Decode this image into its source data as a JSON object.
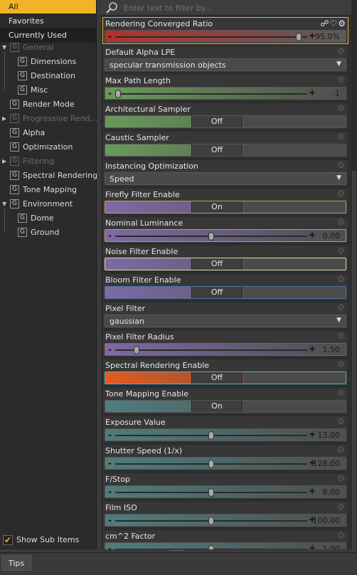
{
  "sidebar": {
    "top": [
      {
        "label": "All",
        "state": "active"
      },
      {
        "label": "Favorites",
        "state": "normal"
      },
      {
        "label": "Currently Used",
        "state": "used"
      }
    ],
    "tree": [
      {
        "label": "General",
        "level": 0,
        "arrow": "▼",
        "disabled": true
      },
      {
        "label": "Dimensions",
        "level": 1,
        "arrow": "",
        "disabled": false
      },
      {
        "label": "Destination",
        "level": 1,
        "arrow": "",
        "disabled": false
      },
      {
        "label": "Misc",
        "level": 1,
        "arrow": "",
        "disabled": false
      },
      {
        "label": "Render Mode",
        "level": 0,
        "arrow": "",
        "disabled": false
      },
      {
        "label": "Progressive Rend...",
        "level": 0,
        "arrow": "▶",
        "disabled": true
      },
      {
        "label": "Alpha",
        "level": 0,
        "arrow": "",
        "disabled": false
      },
      {
        "label": "Optimization",
        "level": 0,
        "arrow": "",
        "disabled": false
      },
      {
        "label": "Filtering",
        "level": 0,
        "arrow": "▶",
        "disabled": true
      },
      {
        "label": "Spectral Rendering",
        "level": 0,
        "arrow": "",
        "disabled": false
      },
      {
        "label": "Tone Mapping",
        "level": 0,
        "arrow": "",
        "disabled": false
      },
      {
        "label": "Environment",
        "level": 0,
        "arrow": "▼",
        "disabled": false
      },
      {
        "label": "Dome",
        "level": 1,
        "arrow": "",
        "disabled": false
      },
      {
        "label": "Ground",
        "level": 1,
        "arrow": "",
        "disabled": false
      }
    ],
    "group_glyph": "G",
    "show_sub_items": {
      "label": "Show Sub Items",
      "checked": true,
      "check_glyph": "✔"
    }
  },
  "search": {
    "placeholder": "Enter text to filter by...",
    "icon": "search-icon"
  },
  "header_icons": "☍♡⚙",
  "gear_glyph": "⚙",
  "properties": [
    {
      "name": "Rendering Converged Ratio",
      "kind": "slider",
      "value": "95.0%",
      "fraction": 0.97,
      "grad": [
        "#b3312b",
        "#5a5a5a"
      ],
      "selected": true,
      "fav_icons": true
    },
    {
      "name": "Default Alpha LPE",
      "kind": "dropdown",
      "value": "specular transmission objects"
    },
    {
      "name": "Max Path Length",
      "kind": "slider",
      "value": "-1",
      "fraction": 0.0,
      "grad": [
        "#6a9a5b",
        "#4e4e4e"
      ]
    },
    {
      "name": "Architectural Sampler",
      "kind": "toggle",
      "value": "Off",
      "grad": [
        "#6a9a5b",
        "#4e4e4e"
      ]
    },
    {
      "name": "Caustic Sampler",
      "kind": "toggle",
      "value": "Off",
      "grad": [
        "#6a9a5b",
        "#4e4e4e"
      ]
    },
    {
      "name": "Instancing Optimization",
      "kind": "dropdown",
      "value": "Speed"
    },
    {
      "name": "Firefly Filter Enable",
      "kind": "toggle",
      "value": "On",
      "grad": [
        "#7e6aa6",
        "#4e4e4e"
      ],
      "border": "#c59a58"
    },
    {
      "name": "Nominal Luminance",
      "kind": "slider",
      "value": "0.00",
      "fraction": 0.5,
      "grad": [
        "#7e6aa6",
        "#4e4e4e"
      ],
      "border": "#c59a58"
    },
    {
      "name": "Noise Filter Enable",
      "kind": "toggle",
      "value": "Off",
      "grad": [
        "#7e6aa6",
        "#4e4e4e"
      ],
      "border": "#d8d8a6"
    },
    {
      "name": "Bloom Filter Enable",
      "kind": "toggle",
      "value": "Off",
      "grad": [
        "#7e6aa6",
        "#4e4e4e"
      ],
      "border": "#4f6fa0"
    },
    {
      "name": "Pixel Filter",
      "kind": "dropdown",
      "value": "gaussian"
    },
    {
      "name": "Pixel Filter Radius",
      "kind": "slider",
      "value": "1.50",
      "fraction": 0.1,
      "grad": [
        "#7e6aa6",
        "#4e4e4e"
      ],
      "border": "#b54a4a"
    },
    {
      "name": "Spectral Rendering Enable",
      "kind": "toggle",
      "value": "Off",
      "grad": [
        "#e55a1f",
        "#4e4e4e"
      ],
      "border": "#4ab4c8"
    },
    {
      "name": "Tone Mapping Enable",
      "kind": "toggle",
      "value": "On",
      "grad": [
        "#4f7d7d",
        "#4e4e4e"
      ]
    },
    {
      "name": "Exposure Value",
      "kind": "slider",
      "value": "13.00",
      "fraction": 0.5,
      "grad": [
        "#4f7d7d",
        "#4e4e4e"
      ]
    },
    {
      "name": "Shutter Speed (1/x)",
      "kind": "slider",
      "value": "128.00",
      "fraction": 0.5,
      "grad": [
        "#4f7d7d",
        "#4e4e4e"
      ]
    },
    {
      "name": "F/Stop",
      "kind": "slider",
      "value": "8.00",
      "fraction": 0.5,
      "grad": [
        "#4f7d7d",
        "#4e4e4e"
      ]
    },
    {
      "name": "Film ISO",
      "kind": "slider",
      "value": "100.00",
      "fraction": 0.5,
      "grad": [
        "#4f7d7d",
        "#4e4e4e"
      ]
    },
    {
      "name": "cm^2 Factor",
      "kind": "slider",
      "value": "1.00",
      "fraction": 0.5,
      "grad": [
        "#4f7d7d",
        "#4e4e4e"
      ]
    }
  ],
  "bottom": {
    "tips_tab": "Tips"
  }
}
